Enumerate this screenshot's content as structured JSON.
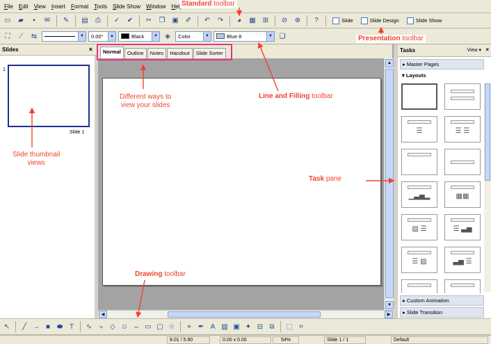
{
  "menu": [
    "File",
    "Edit",
    "View",
    "Insert",
    "Format",
    "Tools",
    "Slide Show",
    "Window",
    "Help"
  ],
  "toolbar": {
    "slide_label": "Slide",
    "slide_design_label": "Slide Design",
    "slide_show_label": "Slide Show"
  },
  "line_toolbar": {
    "width_value": "0.00\"",
    "line_color": "Black",
    "area_style": "Color",
    "fill_color": "Blue 8",
    "line_color_hex": "#000000",
    "fill_color_hex": "#b7c8ec"
  },
  "slides_pane": {
    "title": "Slides",
    "close": "×",
    "slide_number": "1",
    "thumb_label": "Slide 1"
  },
  "view_tabs": [
    "Normal",
    "Outline",
    "Notes",
    "Handout",
    "Slide Sorter"
  ],
  "tasks_pane": {
    "title": "Tasks",
    "view_label": "View ▾",
    "close": "×",
    "master_pages": "Master Pages",
    "layouts": "Layouts",
    "custom_animation": "Custom Animation",
    "slide_transition": "Slide Transition"
  },
  "status": {
    "position": "8.01 / 5.90",
    "size": "0.00 x 0.00",
    "zoom": "54%",
    "slide": "Slide 1 / 1",
    "layout": "Default"
  },
  "annotations": {
    "standard_bold": "Standard",
    "standard_rest": " toolbar",
    "presentation_bold": "Presentation",
    "presentation_rest": " toolbar",
    "line_bold": "Line and Filling",
    "line_rest": " toolbar",
    "views_line1": "Different ways to",
    "views_line2": "view your slides",
    "thumbs_line1": "Slide thumbnail",
    "thumbs_line2": "views",
    "task_bold": "Task",
    "task_rest": " pane",
    "drawing_bold": "Drawing",
    "drawing_rest": " toolbar"
  },
  "colors": {
    "annotation": "#f0422c",
    "tab_highlight": "#e6338a",
    "thumbnail_border": "#1c2f8f"
  }
}
